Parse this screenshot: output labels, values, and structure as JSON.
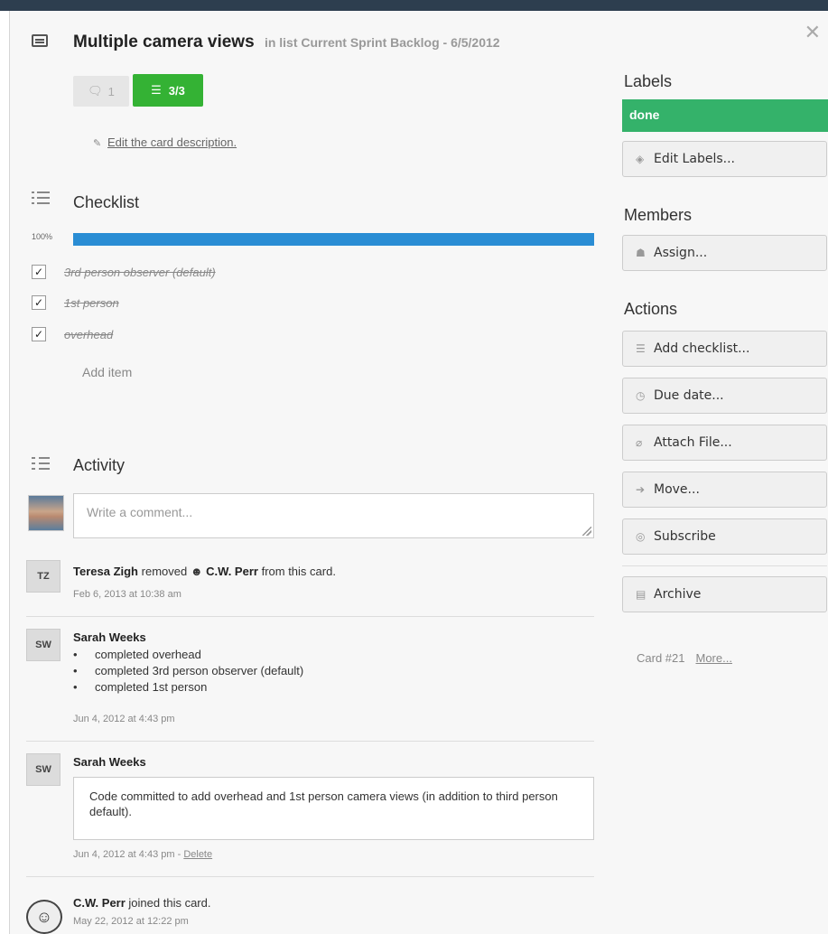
{
  "card": {
    "title": "Multiple camera views",
    "in_list": "in list Current Sprint Backlog - 6/5/2012",
    "comment_badge": "1",
    "checklist_badge": "3/3",
    "edit_description": "Edit the card description."
  },
  "checklist": {
    "title": "Checklist",
    "percent_label": "100%",
    "progress": 1.0,
    "items": [
      {
        "text": "3rd person observer (default)",
        "checked": true
      },
      {
        "text": "1st person",
        "checked": true
      },
      {
        "text": "overhead",
        "checked": true
      }
    ],
    "add_item": "Add item"
  },
  "activity": {
    "title": "Activity",
    "comment_placeholder": "Write a comment...",
    "entries": [
      {
        "initials": "TZ",
        "user": "Teresa Zigh",
        "action": "removed",
        "target": "C.W. Perr",
        "suffix": "from this card.",
        "time": "Feb 6, 2013 at 10:38 am"
      },
      {
        "initials": "SW",
        "user": "Sarah Weeks",
        "bullets": [
          "completed overhead",
          "completed 3rd person observer (default)",
          "completed 1st person"
        ],
        "time": "Jun 4, 2012 at 4:43 pm"
      },
      {
        "initials": "SW",
        "user": "Sarah Weeks",
        "comment": "Code committed to add overhead and 1st person camera views (in addition to third person default).",
        "time": "Jun 4, 2012 at 4:43 pm - ",
        "delete": "Delete"
      },
      {
        "user": "C.W. Perr",
        "action": "joined this card.",
        "time": "May 22, 2012 at 12:22 pm"
      }
    ]
  },
  "sidebar": {
    "labels_heading": "Labels",
    "label_done": "done",
    "edit_labels": "Edit Labels...",
    "members_heading": "Members",
    "assign": "Assign...",
    "actions_heading": "Actions",
    "add_checklist": "Add checklist...",
    "due_date": "Due date...",
    "attach_file": "Attach File...",
    "move": "Move...",
    "subscribe": "Subscribe",
    "archive": "Archive",
    "card_number": "Card #21",
    "more": "More..."
  },
  "colors": {
    "label_green": "#34b26a",
    "badge_green": "#34b234",
    "progress_blue": "#2a8dd4"
  }
}
